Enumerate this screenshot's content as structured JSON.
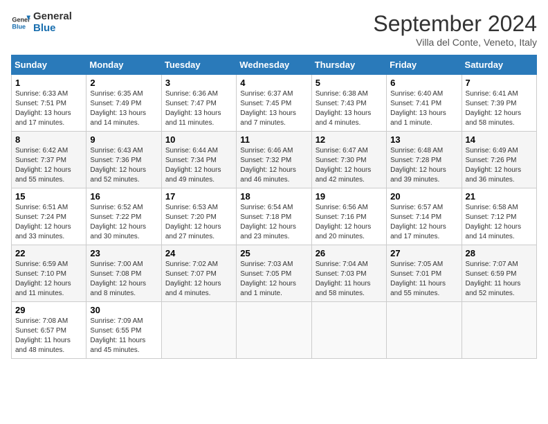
{
  "header": {
    "logo_line1": "General",
    "logo_line2": "Blue",
    "month": "September 2024",
    "location": "Villa del Conte, Veneto, Italy"
  },
  "columns": [
    "Sunday",
    "Monday",
    "Tuesday",
    "Wednesday",
    "Thursday",
    "Friday",
    "Saturday"
  ],
  "weeks": [
    [
      {
        "day": "1",
        "info": "Sunrise: 6:33 AM\nSunset: 7:51 PM\nDaylight: 13 hours\nand 17 minutes."
      },
      {
        "day": "2",
        "info": "Sunrise: 6:35 AM\nSunset: 7:49 PM\nDaylight: 13 hours\nand 14 minutes."
      },
      {
        "day": "3",
        "info": "Sunrise: 6:36 AM\nSunset: 7:47 PM\nDaylight: 13 hours\nand 11 minutes."
      },
      {
        "day": "4",
        "info": "Sunrise: 6:37 AM\nSunset: 7:45 PM\nDaylight: 13 hours\nand 7 minutes."
      },
      {
        "day": "5",
        "info": "Sunrise: 6:38 AM\nSunset: 7:43 PM\nDaylight: 13 hours\nand 4 minutes."
      },
      {
        "day": "6",
        "info": "Sunrise: 6:40 AM\nSunset: 7:41 PM\nDaylight: 13 hours\nand 1 minute."
      },
      {
        "day": "7",
        "info": "Sunrise: 6:41 AM\nSunset: 7:39 PM\nDaylight: 12 hours\nand 58 minutes."
      }
    ],
    [
      {
        "day": "8",
        "info": "Sunrise: 6:42 AM\nSunset: 7:37 PM\nDaylight: 12 hours\nand 55 minutes."
      },
      {
        "day": "9",
        "info": "Sunrise: 6:43 AM\nSunset: 7:36 PM\nDaylight: 12 hours\nand 52 minutes."
      },
      {
        "day": "10",
        "info": "Sunrise: 6:44 AM\nSunset: 7:34 PM\nDaylight: 12 hours\nand 49 minutes."
      },
      {
        "day": "11",
        "info": "Sunrise: 6:46 AM\nSunset: 7:32 PM\nDaylight: 12 hours\nand 46 minutes."
      },
      {
        "day": "12",
        "info": "Sunrise: 6:47 AM\nSunset: 7:30 PM\nDaylight: 12 hours\nand 42 minutes."
      },
      {
        "day": "13",
        "info": "Sunrise: 6:48 AM\nSunset: 7:28 PM\nDaylight: 12 hours\nand 39 minutes."
      },
      {
        "day": "14",
        "info": "Sunrise: 6:49 AM\nSunset: 7:26 PM\nDaylight: 12 hours\nand 36 minutes."
      }
    ],
    [
      {
        "day": "15",
        "info": "Sunrise: 6:51 AM\nSunset: 7:24 PM\nDaylight: 12 hours\nand 33 minutes."
      },
      {
        "day": "16",
        "info": "Sunrise: 6:52 AM\nSunset: 7:22 PM\nDaylight: 12 hours\nand 30 minutes."
      },
      {
        "day": "17",
        "info": "Sunrise: 6:53 AM\nSunset: 7:20 PM\nDaylight: 12 hours\nand 27 minutes."
      },
      {
        "day": "18",
        "info": "Sunrise: 6:54 AM\nSunset: 7:18 PM\nDaylight: 12 hours\nand 23 minutes."
      },
      {
        "day": "19",
        "info": "Sunrise: 6:56 AM\nSunset: 7:16 PM\nDaylight: 12 hours\nand 20 minutes."
      },
      {
        "day": "20",
        "info": "Sunrise: 6:57 AM\nSunset: 7:14 PM\nDaylight: 12 hours\nand 17 minutes."
      },
      {
        "day": "21",
        "info": "Sunrise: 6:58 AM\nSunset: 7:12 PM\nDaylight: 12 hours\nand 14 minutes."
      }
    ],
    [
      {
        "day": "22",
        "info": "Sunrise: 6:59 AM\nSunset: 7:10 PM\nDaylight: 12 hours\nand 11 minutes."
      },
      {
        "day": "23",
        "info": "Sunrise: 7:00 AM\nSunset: 7:08 PM\nDaylight: 12 hours\nand 8 minutes."
      },
      {
        "day": "24",
        "info": "Sunrise: 7:02 AM\nSunset: 7:07 PM\nDaylight: 12 hours\nand 4 minutes."
      },
      {
        "day": "25",
        "info": "Sunrise: 7:03 AM\nSunset: 7:05 PM\nDaylight: 12 hours\nand 1 minute."
      },
      {
        "day": "26",
        "info": "Sunrise: 7:04 AM\nSunset: 7:03 PM\nDaylight: 11 hours\nand 58 minutes."
      },
      {
        "day": "27",
        "info": "Sunrise: 7:05 AM\nSunset: 7:01 PM\nDaylight: 11 hours\nand 55 minutes."
      },
      {
        "day": "28",
        "info": "Sunrise: 7:07 AM\nSunset: 6:59 PM\nDaylight: 11 hours\nand 52 minutes."
      }
    ],
    [
      {
        "day": "29",
        "info": "Sunrise: 7:08 AM\nSunset: 6:57 PM\nDaylight: 11 hours\nand 48 minutes."
      },
      {
        "day": "30",
        "info": "Sunrise: 7:09 AM\nSunset: 6:55 PM\nDaylight: 11 hours\nand 45 minutes."
      },
      {
        "day": "",
        "info": ""
      },
      {
        "day": "",
        "info": ""
      },
      {
        "day": "",
        "info": ""
      },
      {
        "day": "",
        "info": ""
      },
      {
        "day": "",
        "info": ""
      }
    ]
  ]
}
